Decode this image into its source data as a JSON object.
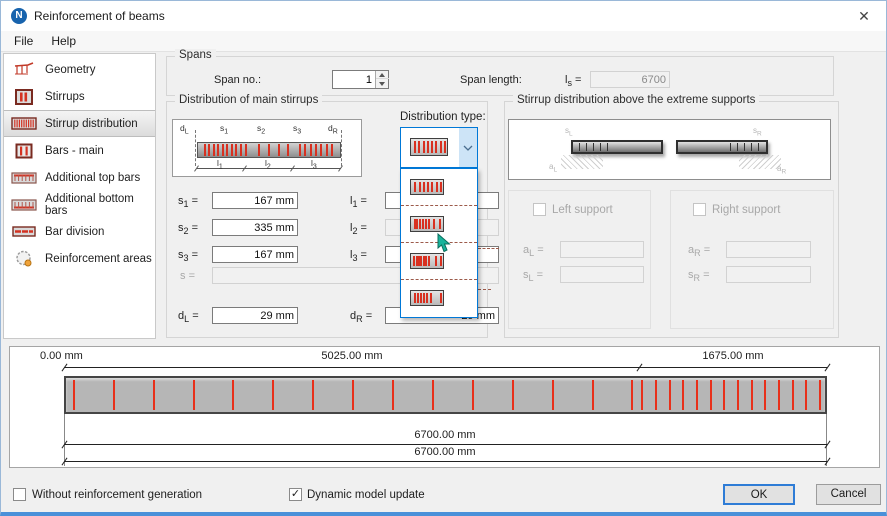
{
  "window": {
    "title": "Reinforcement of beams",
    "close_glyph": "✕",
    "icon_letter": "N"
  },
  "ui": {
    "eq": "=",
    "check": "✓"
  },
  "menu": [
    "File",
    "Help"
  ],
  "sidebar": [
    {
      "id": "geometry",
      "label": "Geometry",
      "selected": false
    },
    {
      "id": "stirrups",
      "label": "Stirrups",
      "selected": false
    },
    {
      "id": "stirrup-distribution",
      "label": "Stirrup distribution",
      "selected": true
    },
    {
      "id": "bars-main",
      "label": "Bars - main",
      "selected": false
    },
    {
      "id": "additional-top-bars",
      "label": "Additional top bars",
      "selected": false
    },
    {
      "id": "additional-bottom-bars",
      "label": "Additional bottom bars",
      "selected": false
    },
    {
      "id": "bar-division",
      "label": "Bar division",
      "selected": false
    },
    {
      "id": "reinforcement-areas",
      "label": "Reinforcement areas",
      "selected": false
    }
  ],
  "spans": {
    "legend": "Spans",
    "span_no_label": "Span no.:",
    "span_no_value": "1",
    "span_length_label": "Span length:",
    "span_length_sym": "l",
    "span_length_sub": "s",
    "span_length_value": "6700"
  },
  "main_stirrups": {
    "legend": "Distribution of main stirrups",
    "diagram": {
      "groups": [
        [
          0.04,
          0.072,
          0.104,
          0.136,
          0.168,
          0.2,
          0.232,
          0.264,
          0.296,
          0.328
        ],
        [
          0.42,
          0.49,
          0.56,
          0.63
        ],
        [
          0.71,
          0.748,
          0.786,
          0.824,
          0.862,
          0.9,
          0.938
        ]
      ],
      "top": [
        {
          "sym": "d",
          "sub": "L"
        },
        {
          "sym": "s",
          "sub": "1"
        },
        {
          "sym": "s",
          "sub": "2"
        },
        {
          "sym": "s",
          "sub": "3"
        },
        {
          "sym": "d",
          "sub": "R"
        }
      ],
      "bottom": [
        {
          "sym": "l",
          "sub": "1"
        },
        {
          "sym": "l",
          "sub": "2"
        },
        {
          "sym": "l",
          "sub": "3"
        }
      ]
    },
    "fields_left": [
      {
        "sym": "s",
        "sub": "1",
        "value": "167 mm"
      },
      {
        "sym": "s",
        "sub": "2",
        "value": "335 mm"
      },
      {
        "sym": "s",
        "sub": "3",
        "value": "167 mm"
      },
      {
        "sym": "s",
        "sub": "",
        "value": ""
      }
    ],
    "fields_right": [
      {
        "sym": "l",
        "sub": "1",
        "value": ""
      },
      {
        "sym": "l",
        "sub": "2",
        "value": ""
      },
      {
        "sym": "l",
        "sub": "3",
        "value": ""
      }
    ],
    "d_left": {
      "sym": "d",
      "sub": "L",
      "value": "29 mm"
    },
    "d_right": {
      "sym": "d",
      "sub": "R",
      "value": "29 mm"
    }
  },
  "distribution_type": {
    "label": "Distribution type:",
    "selected_pattern": [
      0.08,
      0.2,
      0.32,
      0.44,
      0.56,
      0.68,
      0.8,
      0.92
    ],
    "options": [
      {
        "name": "uniform",
        "pattern": [
          0.1,
          0.235,
          0.37,
          0.505,
          0.64,
          0.775,
          0.91
        ]
      },
      {
        "name": "dense-left-then-sparse",
        "pattern": [
          0.08,
          0.17,
          0.26,
          0.35,
          0.44,
          0.53,
          0.7,
          0.88
        ]
      },
      {
        "name": "dense-left",
        "pattern": [
          0.07,
          0.145,
          0.22,
          0.295,
          0.37,
          0.445,
          0.52,
          0.74,
          0.91
        ]
      },
      {
        "name": "dense-left-end-bar",
        "pattern": [
          0.08,
          0.18,
          0.28,
          0.38,
          0.48,
          0.58,
          0.91
        ]
      }
    ]
  },
  "supports": {
    "legend": "Stirrup distribution above the extreme supports",
    "left": {
      "checkbox_label": "Left support",
      "a": {
        "sym": "a",
        "sub": "L",
        "value": ""
      },
      "s": {
        "sym": "s",
        "sub": "L",
        "value": ""
      }
    },
    "right": {
      "checkbox_label": "Right support",
      "a": {
        "sym": "a",
        "sub": "R",
        "value": ""
      },
      "s": {
        "sym": "s",
        "sub": "R",
        "value": ""
      }
    },
    "labels": {
      "sl": {
        "sym": "s",
        "sub": "L"
      },
      "al": {
        "sym": "a",
        "sub": "L"
      },
      "sr": {
        "sym": "s",
        "sub": "R"
      },
      "ar": {
        "sym": "a",
        "sub": "R"
      }
    }
  },
  "beam_view": {
    "dim_top": [
      "0.00 mm",
      "5025.00 mm",
      "1675.00 mm"
    ],
    "dim_bottom": [
      "6700.00 mm",
      "6700.00 mm"
    ],
    "zones": [
      {
        "count": 15,
        "from": 0.009,
        "to": 0.745
      },
      {
        "count": 14,
        "from": 0.758,
        "to": 0.992
      }
    ]
  },
  "footer": {
    "without_label": "Without reinforcement generation",
    "without_checked": false,
    "dynamic_label": "Dynamic model update",
    "dynamic_checked": true,
    "ok_label": "OK",
    "cancel_label": "Cancel"
  },
  "colors": {
    "accent_blue": "#0078d7",
    "stirrup_red": "#d83020",
    "beam_gray": "#b6b6b6",
    "titlebar_icon_blue": "#1763ad"
  }
}
